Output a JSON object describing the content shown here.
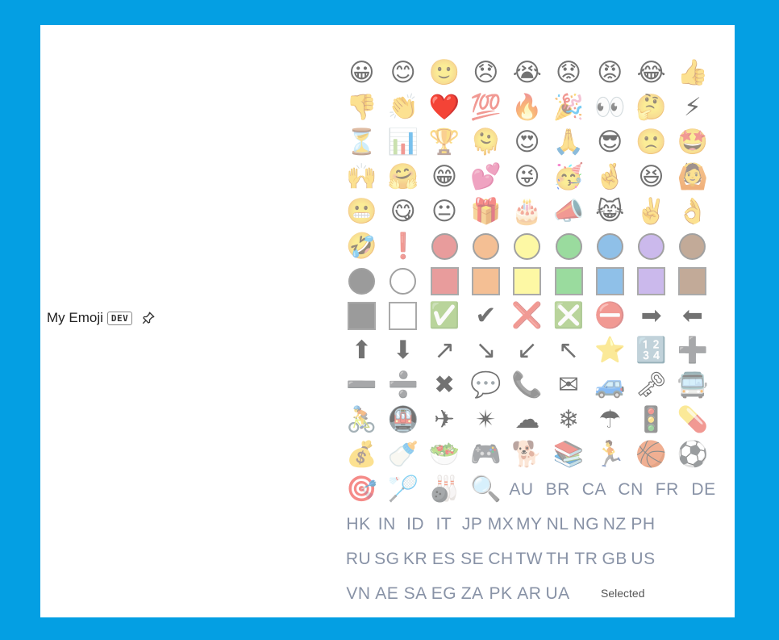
{
  "app": {
    "name": "My Emoji",
    "badge": "DEV"
  },
  "status": {
    "selected_label": "Selected"
  },
  "colors": {
    "frame": "#049fe3",
    "panel": "#ffffff",
    "flag_text": "#8792a8",
    "red": "#e24a4a",
    "orange": "#f58a33",
    "yellow": "#fff44a",
    "green": "#3fc246",
    "blue": "#2d8ee0",
    "purple": "#a47fe6",
    "brown": "#95653f",
    "grey": "#4a4a4a"
  },
  "emoji_rows": [
    [
      "😀",
      "😊",
      "🙂",
      "😞",
      "😭",
      "😟",
      "😡",
      "😂",
      "👍"
    ],
    [
      "👎",
      "👏",
      "❤️",
      "💯",
      "🔥",
      "🎉",
      "👀",
      "🤔",
      "⚡"
    ],
    [
      "⏳",
      "📊",
      "🏆",
      "🫠",
      "😍",
      "🙏",
      "😎",
      "🙁",
      "🤩"
    ],
    [
      "🙌",
      "🤗",
      "😁",
      "💕",
      "😜",
      "🥳",
      "🤞",
      "😆",
      "🙆"
    ],
    [
      "😬",
      "😋",
      "😐",
      "🎁",
      "🎂",
      "📣",
      "😹",
      "✌️",
      "👌"
    ],
    [
      "🤣",
      "❗",
      "red-circle",
      "orange-circle",
      "yellow-circle",
      "green-circle",
      "blue-circle",
      "purple-circle",
      "brown-circle"
    ],
    [
      "black-circle",
      "white-circle",
      "red-square",
      "orange-square",
      "yellow-square",
      "green-square",
      "blue-square",
      "purple-square",
      "brown-square"
    ],
    [
      "black-square",
      "white-square",
      "✅",
      "✔",
      "❌",
      "❎",
      "⛔",
      "➡",
      "⬅"
    ],
    [
      "⬆",
      "⬇",
      "↗",
      "↘",
      "↙",
      "↖",
      "⭐",
      "🔢",
      "➕"
    ],
    [
      "➖",
      "➗",
      "✖",
      "💬",
      "📞",
      "✉",
      "🚙",
      "🗝",
      "🚍"
    ],
    [
      "🚴",
      "🚇",
      "✈",
      "✴",
      "☁",
      "❄",
      "☂",
      "🚦",
      "💊"
    ],
    [
      "💰",
      "🍼",
      "🥗",
      "🎮",
      "🐕",
      "📚",
      "🏃",
      "🏀",
      "⚽"
    ],
    [
      "🎯",
      "🏸",
      "🎳",
      "🔍"
    ]
  ],
  "flags_row0": [
    "AU",
    "BR",
    "CA",
    "CN",
    "FR",
    "DE"
  ],
  "flag_rows": [
    [
      "HK",
      "IN",
      "ID",
      "IT",
      "JP",
      "MX",
      "MY",
      "NL",
      "NG",
      "NZ",
      "PH"
    ],
    [
      "RU",
      "SG",
      "KR",
      "ES",
      "SE",
      "CH",
      "TW",
      "TH",
      "TR",
      "GB",
      "US"
    ],
    [
      "VN",
      "AE",
      "SA",
      "EG",
      "ZA",
      "PK",
      "AR",
      "UA"
    ]
  ],
  "selected_emoji": "❤️"
}
